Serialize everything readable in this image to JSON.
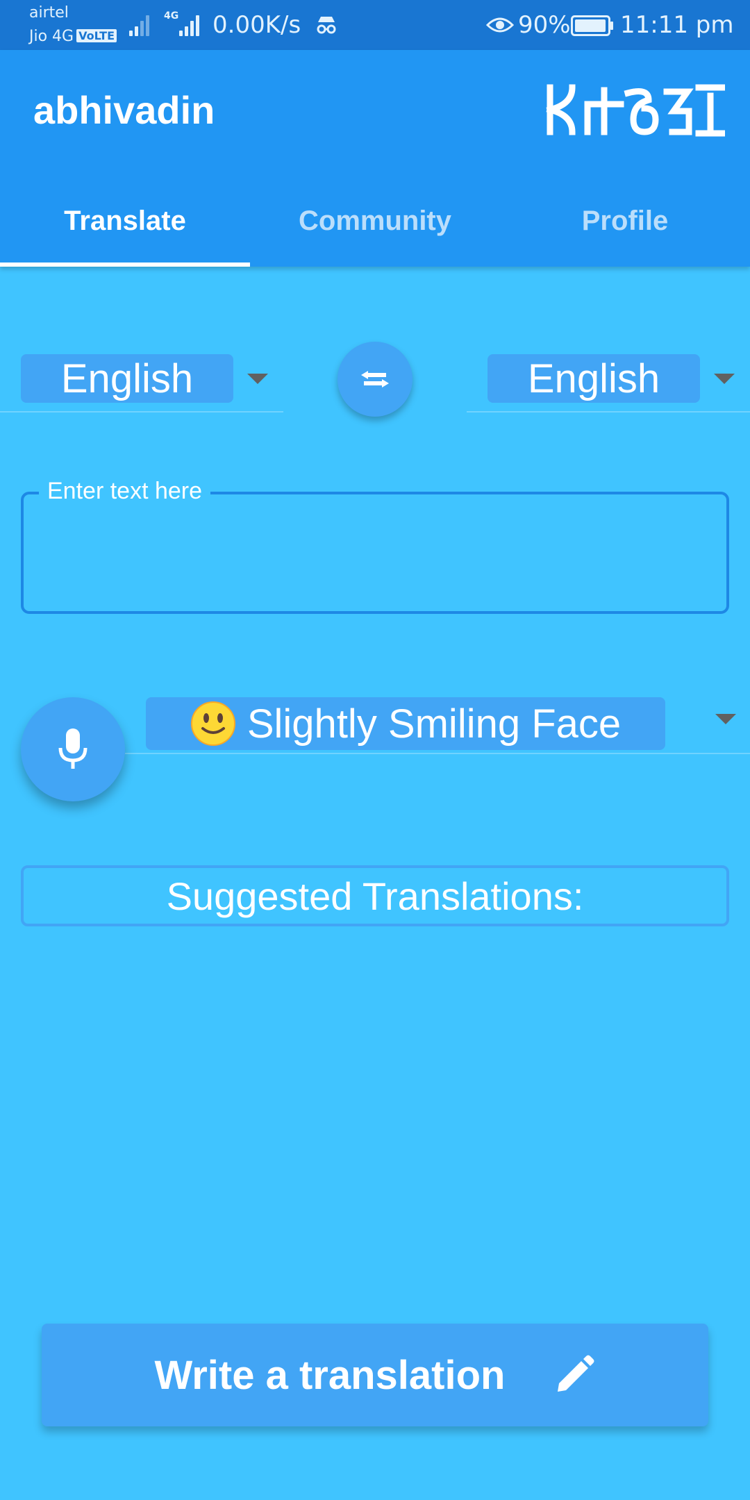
{
  "status_bar": {
    "carrier_primary": "airtel",
    "carrier_secondary": "Jio 4G",
    "volte_badge": "VoLTE",
    "network_type": "4G",
    "net_speed": "0.00K/s",
    "battery_percent": "90%",
    "time": "11:11 pm",
    "icons": [
      "signal-icon",
      "incognito-icon",
      "eye-icon",
      "battery-icon"
    ]
  },
  "app_bar": {
    "title": "abhivadin",
    "logo_icon": "abhivadin-script-logo-icon",
    "tabs": [
      {
        "label": "Translate",
        "active": true
      },
      {
        "label": "Community",
        "active": false
      },
      {
        "label": "Profile",
        "active": false
      }
    ]
  },
  "translate": {
    "source_language": "English",
    "target_language": "English",
    "swap_icon": "swap-horiz-icon",
    "text_field": {
      "label": "Enter text here",
      "value": ""
    },
    "mic_icon": "mic-icon",
    "emoji_select": {
      "emoji": "slightly-smiling-face-emoji",
      "label": "Slightly Smiling Face"
    },
    "suggested_label": "Suggested Translations:",
    "write_button_label": "Write a translation",
    "write_button_icon": "pencil-icon"
  },
  "colors": {
    "status_bar": "#1976d2",
    "app_bar": "#2196f3",
    "background": "#40c4ff",
    "accent": "#42a5f5",
    "field_border": "#1e88e5"
  }
}
